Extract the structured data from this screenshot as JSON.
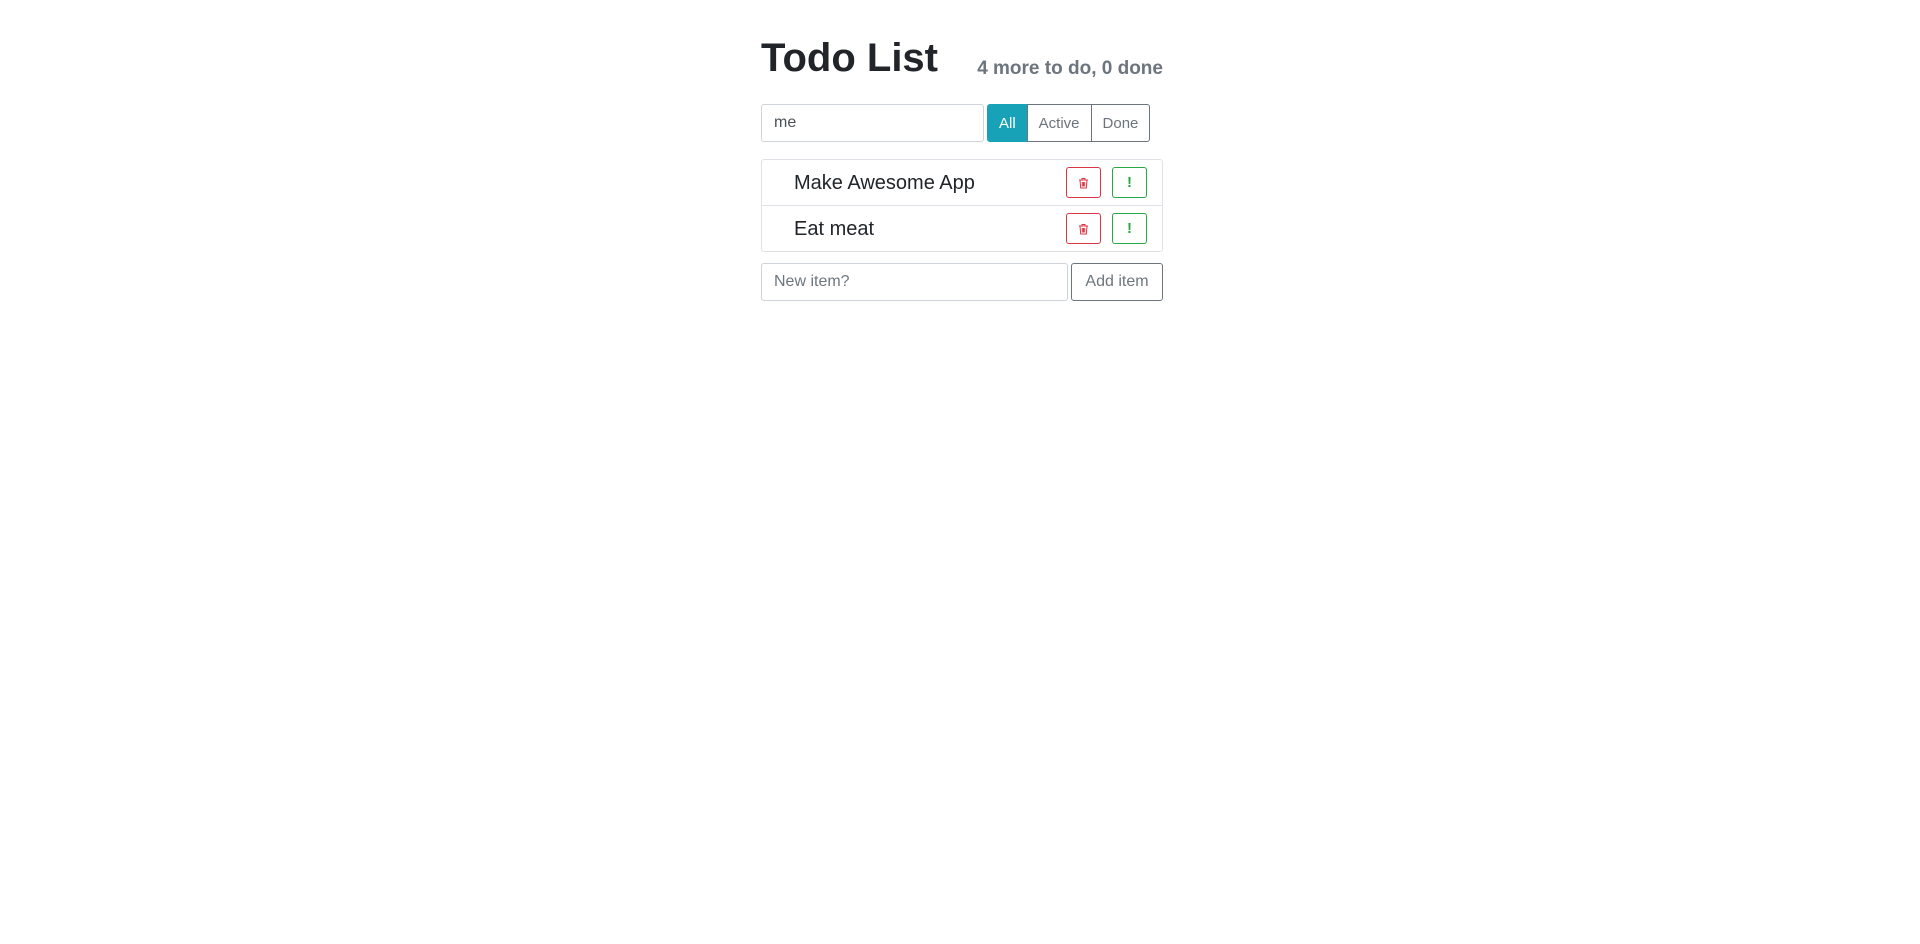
{
  "header": {
    "title": "Todo List",
    "counter": "4 more to do, 0 done"
  },
  "search": {
    "value": "me"
  },
  "filters": [
    {
      "label": "All",
      "active": true
    },
    {
      "label": "Active",
      "active": false
    },
    {
      "label": "Done",
      "active": false
    }
  ],
  "items": [
    {
      "label": "Make Awesome App",
      "delete_icon": "trash-icon",
      "important_label": "!"
    },
    {
      "label": "Eat meat",
      "delete_icon": "trash-icon",
      "important_label": "!"
    }
  ],
  "add": {
    "placeholder": "New item?",
    "button_label": "Add item"
  },
  "colors": {
    "accent": "#17a2b8",
    "danger": "#dc3545",
    "success": "#28a745",
    "muted": "#6c757d"
  }
}
